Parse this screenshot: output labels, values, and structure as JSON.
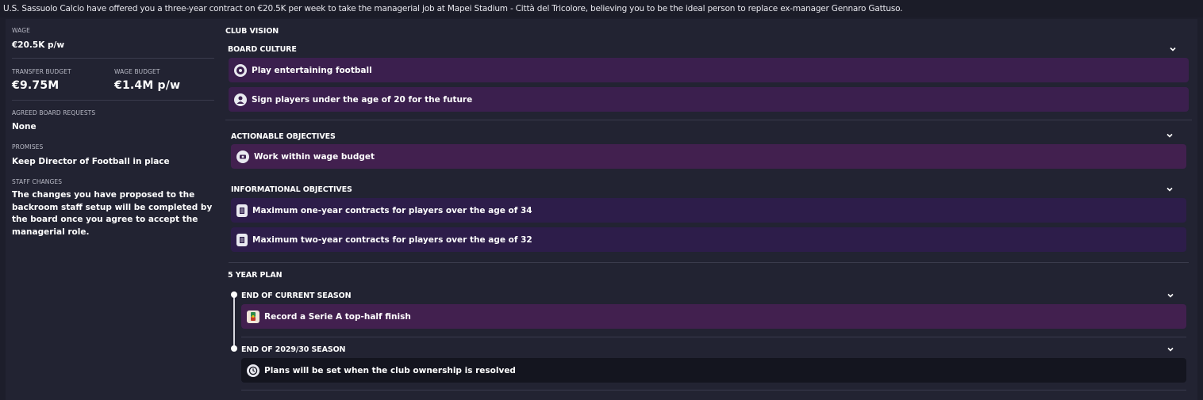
{
  "offer_text": "U.S. Sassuolo Calcio have offered you a three-year contract on €20.5K per week to take the managerial job at Mapei Stadium - Città del Tricolore, believing you to be the ideal person to replace ex-manager Gennaro Gattuso.",
  "summary": {
    "wage_label": "WAGE",
    "wage_value": "€20.5K p/w",
    "transfer_budget_label": "TRANSFER BUDGET",
    "transfer_budget_value": "€9.75M",
    "wage_budget_label": "WAGE BUDGET",
    "wage_budget_value": "€1.4M p/w",
    "board_requests_label": "AGREED BOARD REQUESTS",
    "board_requests_value": "None",
    "promises_label": "PROMISES",
    "promises_value": "Keep Director of Football in place",
    "staff_changes_label": "STAFF CHANGES",
    "staff_changes_value": "The changes you have proposed to the backroom staff setup will be completed by the board once you agree to accept the managerial role."
  },
  "club_vision": {
    "title": "CLUB VISION",
    "board_culture": {
      "title": "BOARD CULTURE",
      "items": [
        {
          "label": "Play entertaining football",
          "icon": "football-icon"
        },
        {
          "label": "Sign players under the age of 20 for the future",
          "icon": "person-icon"
        }
      ]
    },
    "actionable": {
      "title": "ACTIONABLE OBJECTIVES",
      "items": [
        {
          "label": "Work within wage budget",
          "icon": "money-icon"
        }
      ]
    },
    "informational": {
      "title": "INFORMATIONAL OBJECTIVES",
      "items": [
        {
          "label": "Maximum one-year contracts for players over the age of 34",
          "icon": "document-icon"
        },
        {
          "label": "Maximum two-year contracts for players over the age of 32",
          "icon": "document-icon"
        }
      ]
    }
  },
  "five_year_plan": {
    "title": "5 YEAR PLAN",
    "stages": [
      {
        "title": "END OF CURRENT SEASON",
        "items": [
          {
            "label": "Record a Serie A top-half finish",
            "icon": "serie-a-icon"
          }
        ]
      },
      {
        "title": "END OF 2029/30 SEASON",
        "items": [
          {
            "label": "Plans will be set when the club ownership is resolved",
            "icon": "clock-icon"
          }
        ]
      }
    ]
  },
  "colors": {
    "background": "#222332",
    "card_purple": "#3b1f4e",
    "card_dark": "#14151f"
  }
}
